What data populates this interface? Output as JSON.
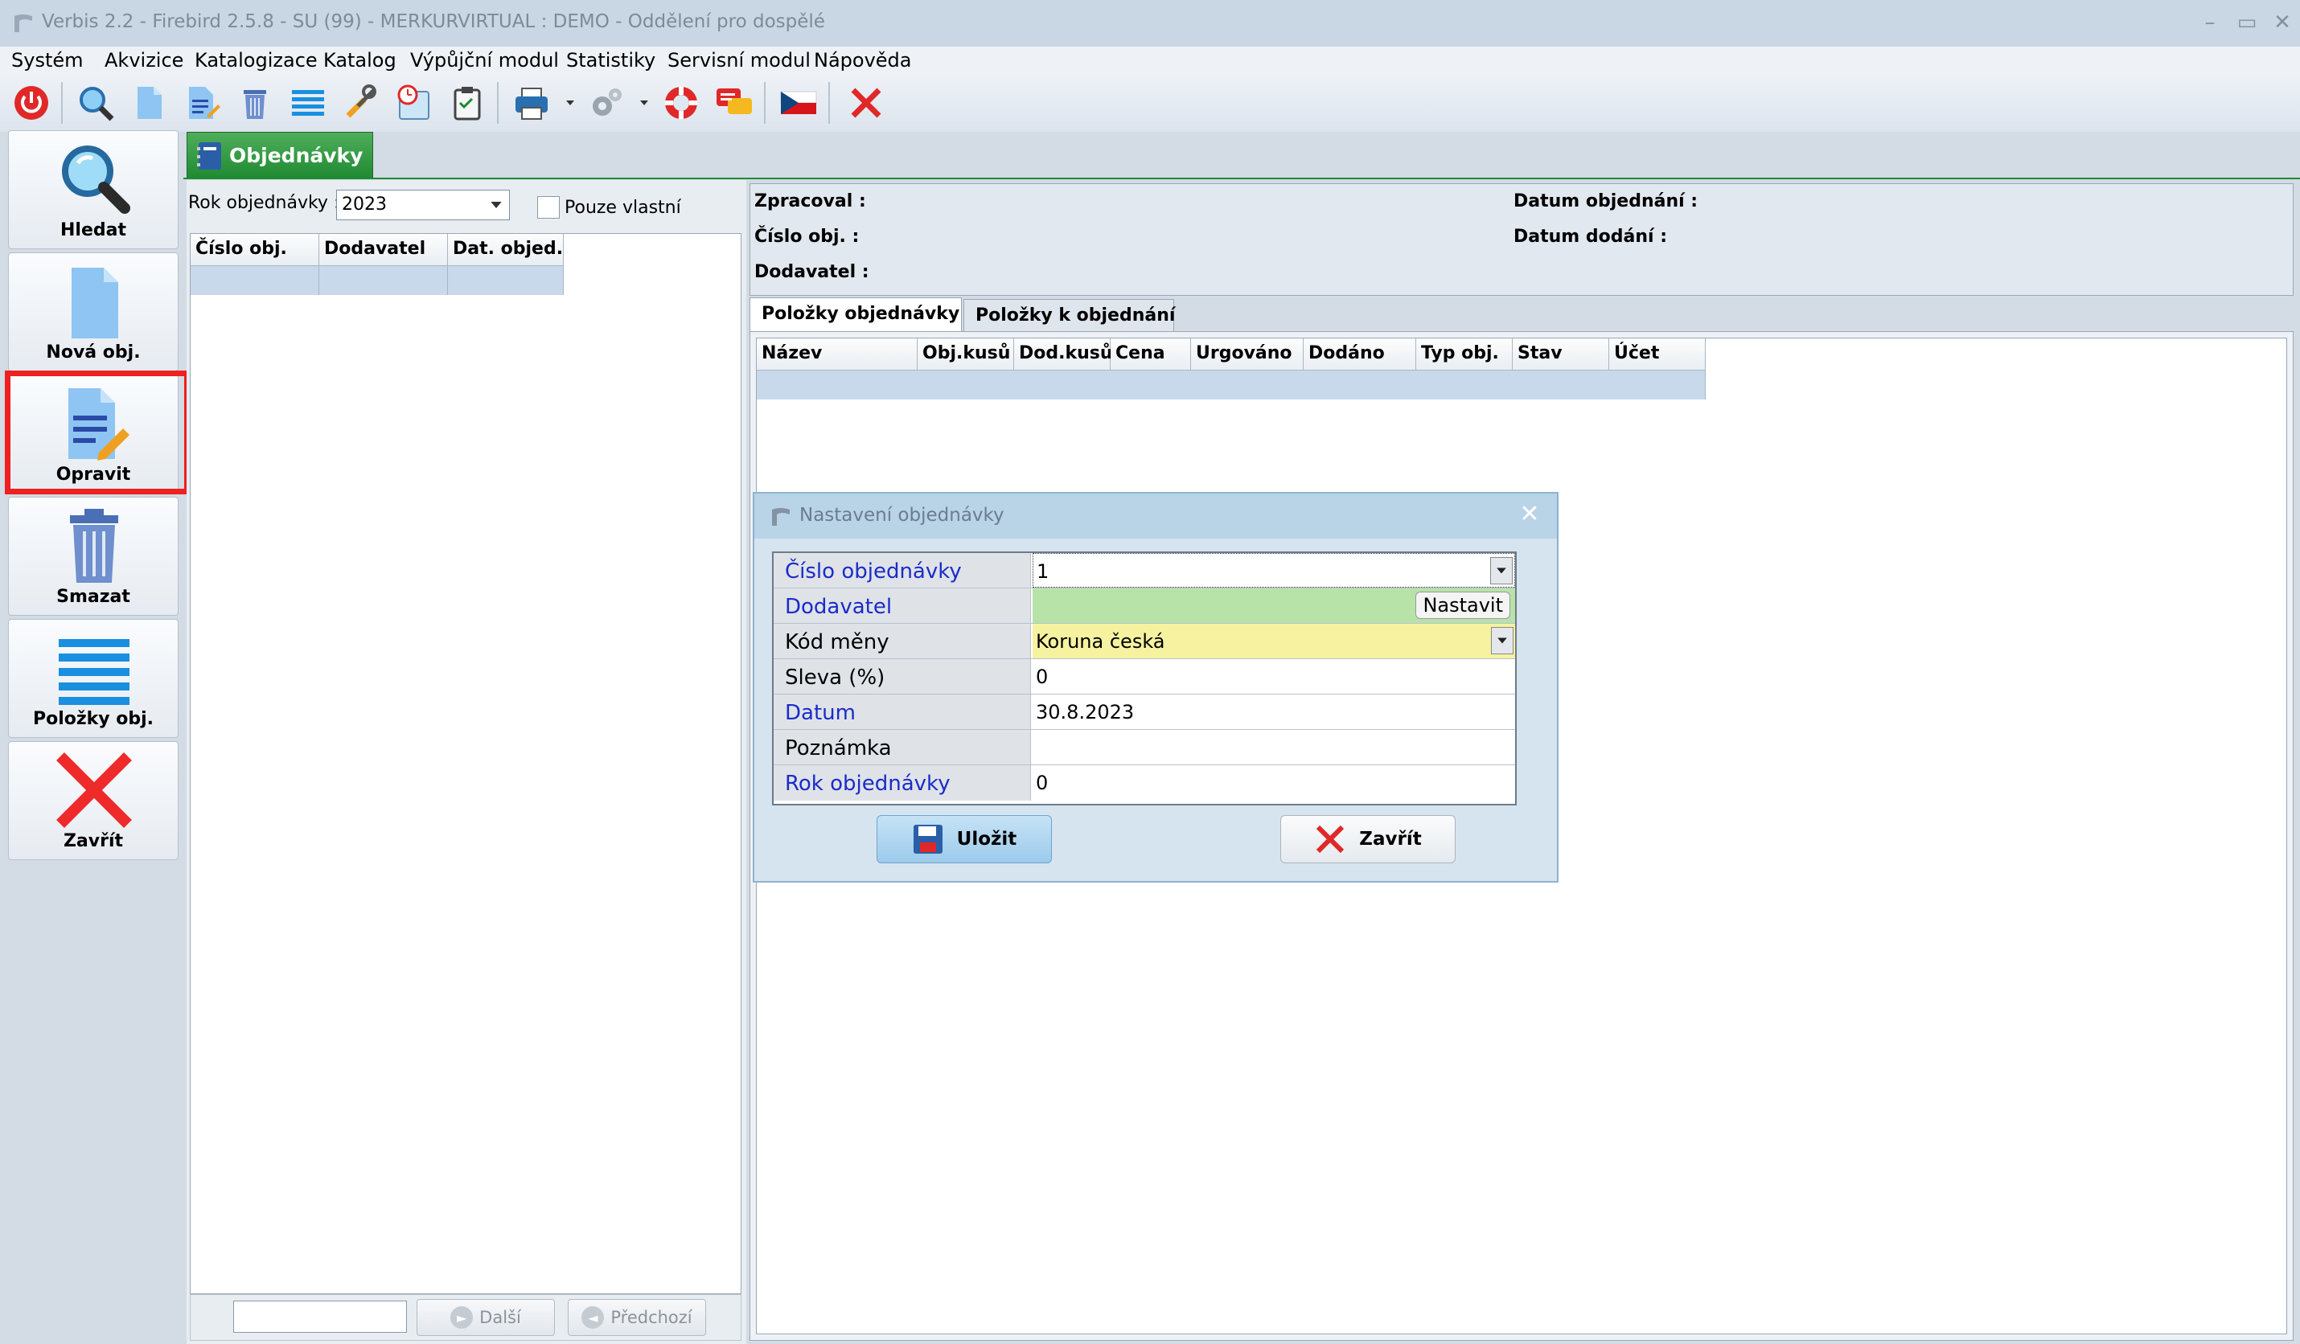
{
  "window": {
    "title": "Verbis 2.2 - Firebird 2.5.8 - SU (99) - MERKURVIRTUAL : DEMO - Oddělení pro dospělé"
  },
  "menu": [
    "Systém",
    "Akvizice",
    "Katalogizace",
    "Katalog",
    "Výpůjční modul",
    "Statistiky",
    "Servisní modul",
    "Nápověda"
  ],
  "toolbar": [
    "power-icon",
    "search-icon",
    "new-document-icon",
    "edit-icon",
    "trash-icon",
    "list-icon",
    "tools-icon",
    "clock-icon",
    "clipboard-icon",
    "printer-icon",
    "gear-icon",
    "lifebuoy-icon",
    "chat-icon",
    "czech-flag-icon",
    "close-icon"
  ],
  "sidebar": [
    {
      "label": "Hledat",
      "icon": "search-icon"
    },
    {
      "label": "Nová obj.",
      "icon": "new-document-icon"
    },
    {
      "label": "Opravit",
      "icon": "edit-icon"
    },
    {
      "label": "Smazat",
      "icon": "trash-icon"
    },
    {
      "label": "Položky obj.",
      "icon": "list-icon"
    },
    {
      "label": "Zavřít",
      "icon": "close-icon"
    }
  ],
  "tab": {
    "label": "Objednávky"
  },
  "filter": {
    "year_label": "Rok objednávky :",
    "year_value": "2023",
    "own_label": "Pouze vlastní"
  },
  "orders": {
    "columns": [
      "Číslo obj.",
      "Dodavatel",
      "Dat. objed."
    ]
  },
  "pager": {
    "next": "Další",
    "prev": "Předchozí"
  },
  "info": {
    "processed_label": "Zpracoval :",
    "number_label": "Číslo obj. :",
    "supplier_label": "Dodavatel :",
    "order_date_label": "Datum objednání :",
    "delivery_date_label": "Datum dodání :"
  },
  "subtabs": [
    "Položky objednávky",
    "Položky k objednání"
  ],
  "items": {
    "columns": [
      "Název",
      "Obj.kusů",
      "Dod.kusů",
      "Cena",
      "Urgováno",
      "Dodáno",
      "Typ obj.",
      "Stav",
      "Účet"
    ]
  },
  "dialog": {
    "title": "Nastavení objednávky",
    "fields": [
      {
        "label": "Číslo objednávky",
        "value": "1"
      },
      {
        "label": "Dodavatel",
        "value": "",
        "button": "Nastavit"
      },
      {
        "label": "Kód měny",
        "value": "Koruna česká"
      },
      {
        "label": "Sleva (%)",
        "value": "0"
      },
      {
        "label": "Datum",
        "value": "30.8.2023"
      },
      {
        "label": "Poznámka",
        "value": ""
      },
      {
        "label": "Rok objednávky",
        "value": "0"
      }
    ],
    "save": "Uložit",
    "close": "Zavřít"
  },
  "colors": {
    "accent_green": "#1f8a32",
    "required_label": "#1a2cc9",
    "highlight": "#ee2020",
    "supplier_bg": "#b8e3a8",
    "currency_bg": "#f6f2a0"
  }
}
